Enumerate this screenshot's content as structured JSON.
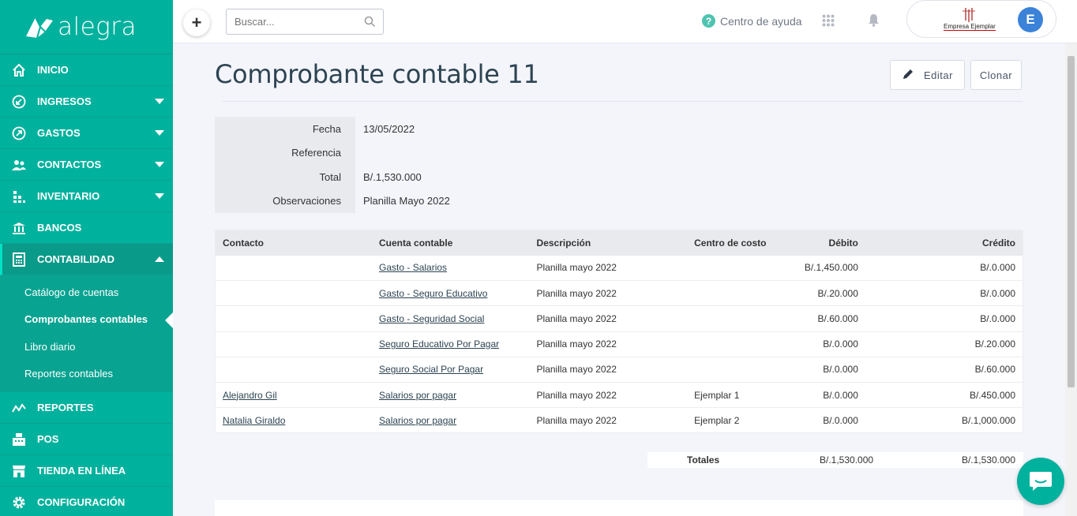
{
  "brand": {
    "name": "alegra"
  },
  "sidebar": {
    "items": [
      {
        "label": "INICIO"
      },
      {
        "label": "INGRESOS"
      },
      {
        "label": "GASTOS"
      },
      {
        "label": "CONTACTOS"
      },
      {
        "label": "INVENTARIO"
      },
      {
        "label": "BANCOS"
      },
      {
        "label": "CONTABILIDAD"
      },
      {
        "label": "REPORTES"
      },
      {
        "label": "POS"
      },
      {
        "label": "TIENDA EN LÍNEA"
      },
      {
        "label": "CONFIGURACIÓN"
      }
    ],
    "submenu": [
      {
        "label": "Catálogo de cuentas"
      },
      {
        "label": "Comprobantes contables"
      },
      {
        "label": "Libro diario"
      },
      {
        "label": "Reportes contables"
      }
    ]
  },
  "topbar": {
    "search_placeholder": "Buscar...",
    "help_label": "Centro de ayuda",
    "company_name": "Empresa Ejemplar",
    "avatar_initial": "E"
  },
  "page": {
    "title": "Comprobante contable 11",
    "edit_label": "Editar",
    "clone_label": "Clonar"
  },
  "info": [
    {
      "label": "Fecha",
      "value": "13/05/2022"
    },
    {
      "label": "Referencia",
      "value": ""
    },
    {
      "label": "Total",
      "value": "B/.1,530.000"
    },
    {
      "label": "Observaciones",
      "value": "Planilla Mayo 2022"
    }
  ],
  "table": {
    "headers": [
      "Contacto",
      "Cuenta contable",
      "Descripción",
      "Centro de costo",
      "Débito",
      "Crédito"
    ],
    "rows": [
      {
        "contact": "",
        "account": "Gasto - Salarios",
        "description": "Planilla mayo 2022",
        "cost_center": "",
        "debit": "B/.1,450.000",
        "credit": "B/.0.000"
      },
      {
        "contact": "",
        "account": "Gasto - Seguro Educativo",
        "description": "Planilla mayo 2022",
        "cost_center": "",
        "debit": "B/.20.000",
        "credit": "B/.0.000"
      },
      {
        "contact": "",
        "account": "Gasto - Seguridad Social",
        "description": "Planilla mayo 2022",
        "cost_center": "",
        "debit": "B/.60.000",
        "credit": "B/.0.000"
      },
      {
        "contact": "",
        "account": "Seguro Educativo Por Pagar",
        "description": "Planilla mayo 2022",
        "cost_center": "",
        "debit": "B/.0.000",
        "credit": "B/.20.000"
      },
      {
        "contact": "",
        "account": "Seguro Social Por Pagar",
        "description": "Planilla mayo 2022",
        "cost_center": "",
        "debit": "B/.0.000",
        "credit": "B/.60.000"
      },
      {
        "contact": "Alejandro Gil",
        "account": "Salarios por pagar",
        "description": "Planilla mayo 2022",
        "cost_center": "Ejemplar 1",
        "debit": "B/.0.000",
        "credit": "B/.450.000"
      },
      {
        "contact": "Natalia Giraldo",
        "account": "Salarios por pagar",
        "description": "Planilla mayo 2022",
        "cost_center": "Ejemplar 2",
        "debit": "B/.0.000",
        "credit": "B/.1,000.000"
      }
    ]
  },
  "totals": {
    "label": "Totales",
    "debit": "B/.1,530.000",
    "credit": "B/.1,530.000"
  },
  "colors": {
    "brand": "#00b19d",
    "title": "#2d4452",
    "avatar": "#3b82d9"
  }
}
